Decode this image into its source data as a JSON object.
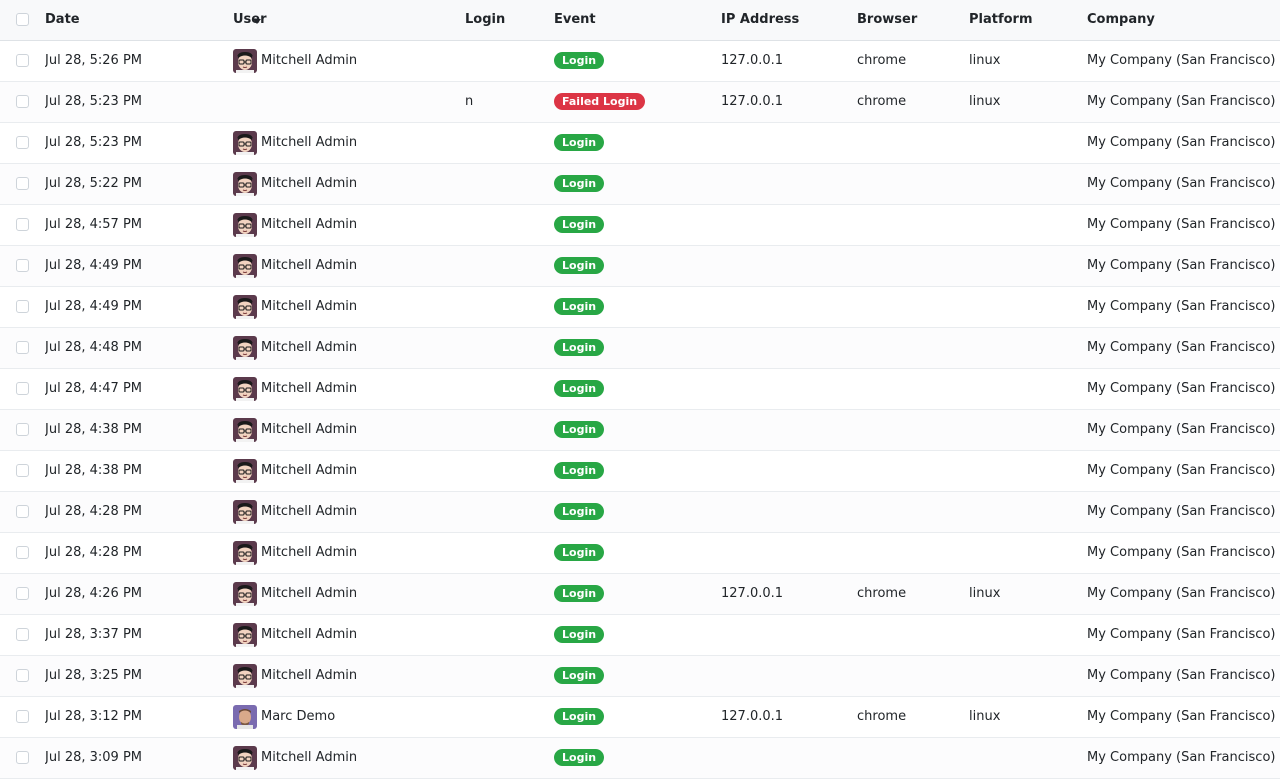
{
  "columns": {
    "date": "Date",
    "user": "User",
    "login": "Login",
    "event": "Event",
    "ip": "IP Address",
    "browser": "Browser",
    "platform": "Platform",
    "company": "Company"
  },
  "sort": {
    "column": "date",
    "direction": "descending"
  },
  "colors": {
    "login": "#28a745",
    "failed_login": "#dc3545",
    "avatar_admin": "#5b3a4c",
    "avatar_demo": "#7a6bb0"
  },
  "rows": [
    {
      "date": "Jul 28, 5:26 PM",
      "user": "Mitchell Admin",
      "avatar": "admin",
      "login": "",
      "event": "Login",
      "status": "login",
      "ip": "127.0.0.1",
      "browser": "chrome",
      "platform": "linux",
      "company": "My Company (San Francisco)"
    },
    {
      "date": "Jul 28, 5:23 PM",
      "user": "",
      "avatar": "",
      "login": "n",
      "event": "Failed Login",
      "status": "failed",
      "ip": "127.0.0.1",
      "browser": "chrome",
      "platform": "linux",
      "company": "My Company (San Francisco)"
    },
    {
      "date": "Jul 28, 5:23 PM",
      "user": "Mitchell Admin",
      "avatar": "admin",
      "login": "",
      "event": "Login",
      "status": "login",
      "ip": "",
      "browser": "",
      "platform": "",
      "company": "My Company (San Francisco)"
    },
    {
      "date": "Jul 28, 5:22 PM",
      "user": "Mitchell Admin",
      "avatar": "admin",
      "login": "",
      "event": "Login",
      "status": "login",
      "ip": "",
      "browser": "",
      "platform": "",
      "company": "My Company (San Francisco)"
    },
    {
      "date": "Jul 28, 4:57 PM",
      "user": "Mitchell Admin",
      "avatar": "admin",
      "login": "",
      "event": "Login",
      "status": "login",
      "ip": "",
      "browser": "",
      "platform": "",
      "company": "My Company (San Francisco)"
    },
    {
      "date": "Jul 28, 4:49 PM",
      "user": "Mitchell Admin",
      "avatar": "admin",
      "login": "",
      "event": "Login",
      "status": "login",
      "ip": "",
      "browser": "",
      "platform": "",
      "company": "My Company (San Francisco)"
    },
    {
      "date": "Jul 28, 4:49 PM",
      "user": "Mitchell Admin",
      "avatar": "admin",
      "login": "",
      "event": "Login",
      "status": "login",
      "ip": "",
      "browser": "",
      "platform": "",
      "company": "My Company (San Francisco)"
    },
    {
      "date": "Jul 28, 4:48 PM",
      "user": "Mitchell Admin",
      "avatar": "admin",
      "login": "",
      "event": "Login",
      "status": "login",
      "ip": "",
      "browser": "",
      "platform": "",
      "company": "My Company (San Francisco)"
    },
    {
      "date": "Jul 28, 4:47 PM",
      "user": "Mitchell Admin",
      "avatar": "admin",
      "login": "",
      "event": "Login",
      "status": "login",
      "ip": "",
      "browser": "",
      "platform": "",
      "company": "My Company (San Francisco)"
    },
    {
      "date": "Jul 28, 4:38 PM",
      "user": "Mitchell Admin",
      "avatar": "admin",
      "login": "",
      "event": "Login",
      "status": "login",
      "ip": "",
      "browser": "",
      "platform": "",
      "company": "My Company (San Francisco)"
    },
    {
      "date": "Jul 28, 4:38 PM",
      "user": "Mitchell Admin",
      "avatar": "admin",
      "login": "",
      "event": "Login",
      "status": "login",
      "ip": "",
      "browser": "",
      "platform": "",
      "company": "My Company (San Francisco)"
    },
    {
      "date": "Jul 28, 4:28 PM",
      "user": "Mitchell Admin",
      "avatar": "admin",
      "login": "",
      "event": "Login",
      "status": "login",
      "ip": "",
      "browser": "",
      "platform": "",
      "company": "My Company (San Francisco)"
    },
    {
      "date": "Jul 28, 4:28 PM",
      "user": "Mitchell Admin",
      "avatar": "admin",
      "login": "",
      "event": "Login",
      "status": "login",
      "ip": "",
      "browser": "",
      "platform": "",
      "company": "My Company (San Francisco)"
    },
    {
      "date": "Jul 28, 4:26 PM",
      "user": "Mitchell Admin",
      "avatar": "admin",
      "login": "",
      "event": "Login",
      "status": "login",
      "ip": "127.0.0.1",
      "browser": "chrome",
      "platform": "linux",
      "company": "My Company (San Francisco)"
    },
    {
      "date": "Jul 28, 3:37 PM",
      "user": "Mitchell Admin",
      "avatar": "admin",
      "login": "",
      "event": "Login",
      "status": "login",
      "ip": "",
      "browser": "",
      "platform": "",
      "company": "My Company (San Francisco)"
    },
    {
      "date": "Jul 28, 3:25 PM",
      "user": "Mitchell Admin",
      "avatar": "admin",
      "login": "",
      "event": "Login",
      "status": "login",
      "ip": "",
      "browser": "",
      "platform": "",
      "company": "My Company (San Francisco)"
    },
    {
      "date": "Jul 28, 3:12 PM",
      "user": "Marc Demo",
      "avatar": "demo",
      "login": "",
      "event": "Login",
      "status": "login",
      "ip": "127.0.0.1",
      "browser": "chrome",
      "platform": "linux",
      "company": "My Company (San Francisco)"
    },
    {
      "date": "Jul 28, 3:09 PM",
      "user": "Mitchell Admin",
      "avatar": "admin",
      "login": "",
      "event": "Login",
      "status": "login",
      "ip": "",
      "browser": "",
      "platform": "",
      "company": "My Company (San Francisco)"
    }
  ]
}
